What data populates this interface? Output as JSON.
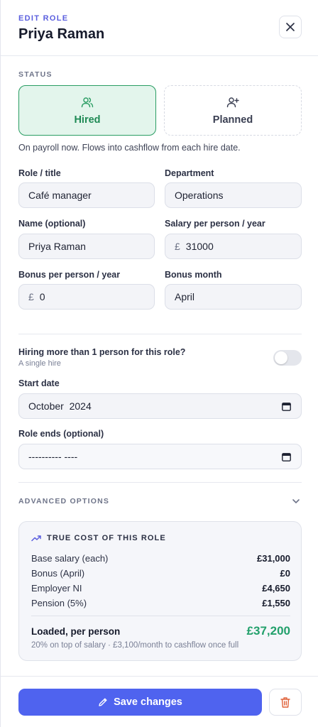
{
  "header": {
    "eyebrow": "EDIT ROLE",
    "title": "Priya Raman"
  },
  "status": {
    "section_label": "STATUS",
    "options": [
      {
        "label": "Hired",
        "icon": "users-icon",
        "selected": true
      },
      {
        "label": "Planned",
        "icon": "user-plus-icon",
        "selected": false
      }
    ],
    "hint": "On payroll now. Flows into cashflow from each hire date."
  },
  "fields": {
    "role_title": {
      "label": "Role / title",
      "value": "Café manager"
    },
    "department": {
      "label": "Department",
      "value": "Operations"
    },
    "name": {
      "label": "Name (optional)",
      "value": "Priya Raman"
    },
    "salary": {
      "label": "Salary per person / year",
      "prefix": "£",
      "value": "31000"
    },
    "bonus": {
      "label": "Bonus per person / year",
      "prefix": "£",
      "value": "0"
    },
    "bonus_month": {
      "label": "Bonus month",
      "value": "April"
    },
    "start_date": {
      "label": "Start date",
      "value": "October  2024"
    },
    "role_ends": {
      "label": "Role ends (optional)",
      "value": "---------- ----"
    }
  },
  "multi_hire": {
    "label": "Hiring more than 1 person for this role?",
    "sub": "A single hire",
    "enabled": false
  },
  "advanced": {
    "label": "ADVANCED OPTIONS"
  },
  "cost": {
    "title": "TRUE COST OF THIS ROLE",
    "rows": [
      {
        "label": "Base salary (each)",
        "value": "£31,000"
      },
      {
        "label": "Bonus (April)",
        "value": "£0"
      },
      {
        "label": "Employer NI",
        "value": "£4,650"
      },
      {
        "label": "Pension (5%)",
        "value": "£1,550"
      }
    ],
    "loaded_label": "Loaded, per person",
    "loaded_value": "£37,200",
    "footnote": "20% on top of salary · £3,100/month to cashflow once full"
  },
  "footer": {
    "save_label": "Save changes"
  },
  "colors": {
    "accent": "#4f63ef",
    "success": "#22a06b",
    "danger": "#e0623a",
    "eyebrow": "#5b5fdf"
  }
}
